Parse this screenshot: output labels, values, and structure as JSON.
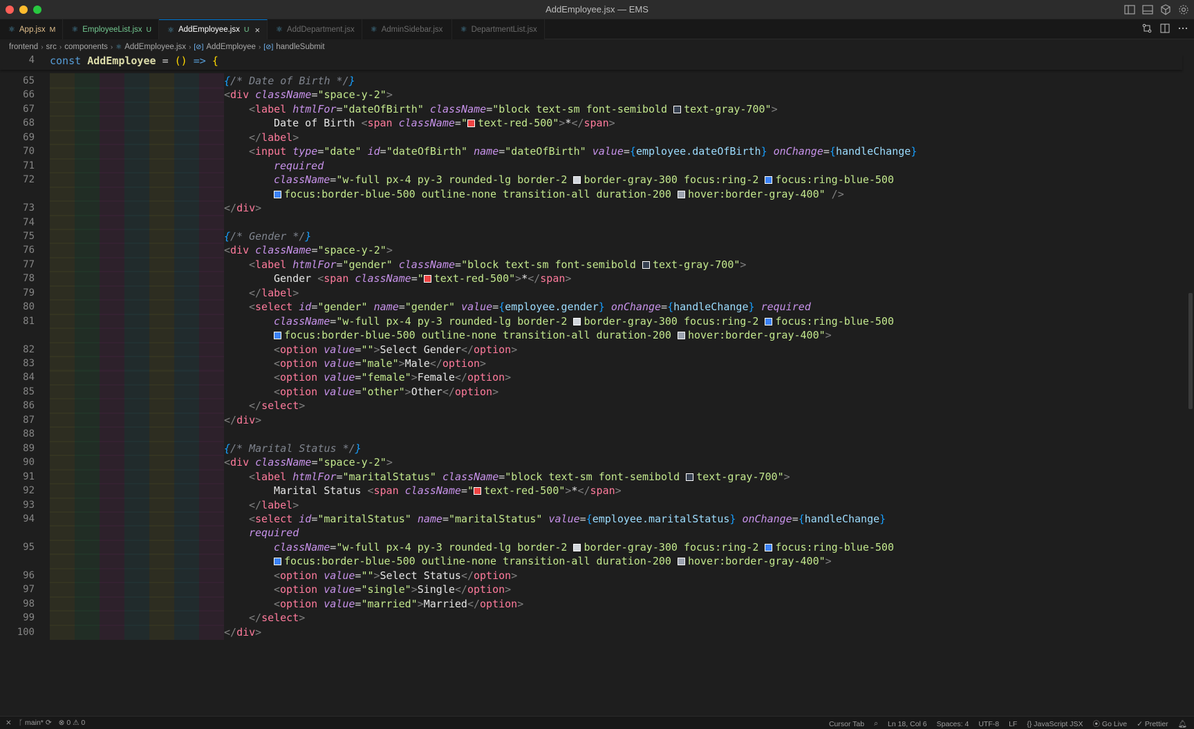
{
  "window": {
    "title": "AddEmployee.jsx — EMS"
  },
  "tabs": [
    {
      "label": "App.jsx",
      "status": "M",
      "state": "modified",
      "icon": "react-icon"
    },
    {
      "label": "EmployeeList.jsx",
      "status": "U",
      "state": "untracked",
      "icon": "react-icon"
    },
    {
      "label": "AddEmployee.jsx",
      "status": "U",
      "state": "active",
      "icon": "react-icon",
      "close": "×"
    },
    {
      "label": "AddDepartment.jsx",
      "status": "",
      "state": "dim",
      "icon": "react-icon"
    },
    {
      "label": "AdminSidebar.jsx",
      "status": "",
      "state": "dim",
      "icon": "react-icon"
    },
    {
      "label": "DepartmentList.jsx",
      "status": "",
      "state": "dim",
      "icon": "react-icon"
    }
  ],
  "breadcrumb": [
    "frontend",
    "src",
    "components",
    "AddEmployee.jsx",
    "AddEmployee",
    "handleSubmit"
  ],
  "editor": {
    "sticky_line": "4",
    "rows": [
      {
        "n": "65",
        "html": "<span class='k-cmg'><span class='k-br'>{</span>/* Date of Birth */<span class='k-br'>}</span></span>",
        "indent": 4
      },
      {
        "n": "66",
        "html": "<span class='k-tag'>&lt;</span><span class='k-tname'>div</span> <span class='k-attr'>className</span>=<span class='k-str'>\"space-y-2\"</span><span class='k-tag'>&gt;</span>",
        "indent": 4
      },
      {
        "n": "67",
        "html": "<span class='k-tag'>&lt;</span><span class='k-tname'>label</span> <span class='k-attr'>htmlFor</span>=<span class='k-str'>\"dateOfBirth\"</span> <span class='k-attr'>className</span>=<span class='k-str'>\"block text-sm font-semibold <i class='swatch' style='background:#374151'></i>text-gray-700\"</span><span class='k-tag'>&gt;</span>",
        "indent": 8
      },
      {
        "n": "68",
        "html": "<span class='k-txt'>Date of Birth </span><span class='k-tag'>&lt;</span><span class='k-tname'>span</span> <span class='k-attr'>className</span>=<span class='k-str'>\"<i class='swatch' style='background:#ef4444'></i>text-red-500\"</span><span class='k-tag'>&gt;</span><span class='k-txt'>*</span><span class='k-tag'>&lt;/</span><span class='k-tname'>span</span><span class='k-tag'>&gt;</span>",
        "indent": 12
      },
      {
        "n": "69",
        "html": "<span class='k-tag'>&lt;/</span><span class='k-tname'>label</span><span class='k-tag'>&gt;</span>",
        "indent": 8
      },
      {
        "n": "70",
        "html": "<span class='k-tag'>&lt;</span><span class='k-tname'>input</span> <span class='k-attr'>type</span>=<span class='k-str'>\"date\"</span> <span class='k-attr'>id</span>=<span class='k-str'>\"dateOfBirth\"</span> <span class='k-attr'>name</span>=<span class='k-str'>\"dateOfBirth\"</span> <span class='k-attr'>value</span>=<span class='k-br'>{</span><span class='k-var'>employee.dateOfBirth</span><span class='k-br'>}</span> <span class='k-attr'>onChange</span>=<span class='k-br'>{</span><span class='k-var'>handleChange</span><span class='k-br'>}</span>",
        "indent": 8
      },
      {
        "n": "71",
        "html": "<span class='k-attr'>required</span>",
        "indent": 12
      },
      {
        "n": "72",
        "html": "<span class='k-attr'>className</span>=<span class='k-str'>\"w-full px-4 py-3 rounded-lg border-2 <i class='swatch' style='background:#d1d5db'></i>border-gray-300 focus:ring-2 <i class='swatch' style='background:#3b82f6'></i>focus:ring-blue-500</span>",
        "indent": 12
      },
      {
        "n": "",
        "html": "<span class='k-str'><i class='swatch' style='background:#3b82f6'></i>focus:border-blue-500 outline-none transition-all duration-200 <i class='swatch' style='background:#9ca3af'></i>hover:border-gray-400\"</span> <span class='k-tag'>/&gt;</span>",
        "indent": 12
      },
      {
        "n": "73",
        "html": "<span class='k-tag'>&lt;/</span><span class='k-tname'>div</span><span class='k-tag'>&gt;</span>",
        "indent": 4
      },
      {
        "n": "74",
        "html": "",
        "indent": 0
      },
      {
        "n": "75",
        "html": "<span class='k-cmg'><span class='k-br'>{</span>/* Gender */<span class='k-br'>}</span></span>",
        "indent": 4
      },
      {
        "n": "76",
        "html": "<span class='k-tag'>&lt;</span><span class='k-tname'>div</span> <span class='k-attr'>className</span>=<span class='k-str'>\"space-y-2\"</span><span class='k-tag'>&gt;</span>",
        "indent": 4
      },
      {
        "n": "77",
        "html": "<span class='k-tag'>&lt;</span><span class='k-tname'>label</span> <span class='k-attr'>htmlFor</span>=<span class='k-str'>\"gender\"</span> <span class='k-attr'>className</span>=<span class='k-str'>\"block text-sm font-semibold <i class='swatch' style='background:#374151'></i>text-gray-700\"</span><span class='k-tag'>&gt;</span>",
        "indent": 8
      },
      {
        "n": "78",
        "html": "<span class='k-txt'>Gender </span><span class='k-tag'>&lt;</span><span class='k-tname'>span</span> <span class='k-attr'>className</span>=<span class='k-str'>\"<i class='swatch' style='background:#ef4444'></i>text-red-500\"</span><span class='k-tag'>&gt;</span><span class='k-txt'>*</span><span class='k-tag'>&lt;/</span><span class='k-tname'>span</span><span class='k-tag'>&gt;</span>",
        "indent": 12
      },
      {
        "n": "79",
        "html": "<span class='k-tag'>&lt;/</span><span class='k-tname'>label</span><span class='k-tag'>&gt;</span>",
        "indent": 8
      },
      {
        "n": "80",
        "html": "<span class='k-tag'>&lt;</span><span class='k-tname'>select</span> <span class='k-attr'>id</span>=<span class='k-str'>\"gender\"</span> <span class='k-attr'>name</span>=<span class='k-str'>\"gender\"</span> <span class='k-attr'>value</span>=<span class='k-br'>{</span><span class='k-var'>employee.gender</span><span class='k-br'>}</span> <span class='k-attr'>onChange</span>=<span class='k-br'>{</span><span class='k-var'>handleChange</span><span class='k-br'>}</span> <span class='k-attr'>required</span>",
        "indent": 8
      },
      {
        "n": "81",
        "html": "<span class='k-attr'>className</span>=<span class='k-str'>\"w-full px-4 py-3 rounded-lg border-2 <i class='swatch' style='background:#d1d5db'></i>border-gray-300 focus:ring-2 <i class='swatch' style='background:#3b82f6'></i>focus:ring-blue-500</span>",
        "indent": 12
      },
      {
        "n": "",
        "html": "<span class='k-str'><i class='swatch' style='background:#3b82f6'></i>focus:border-blue-500 outline-none transition-all duration-200 <i class='swatch' style='background:#9ca3af'></i>hover:border-gray-400\"</span><span class='k-tag'>&gt;</span>",
        "indent": 12
      },
      {
        "n": "82",
        "html": "<span class='k-tag'>&lt;</span><span class='k-tname'>option</span> <span class='k-attr'>value</span>=<span class='k-str'>\"\"</span><span class='k-tag'>&gt;</span><span class='k-txt'>Select Gender</span><span class='k-tag'>&lt;/</span><span class='k-tname'>option</span><span class='k-tag'>&gt;</span>",
        "indent": 12
      },
      {
        "n": "83",
        "html": "<span class='k-tag'>&lt;</span><span class='k-tname'>option</span> <span class='k-attr'>value</span>=<span class='k-str'>\"male\"</span><span class='k-tag'>&gt;</span><span class='k-txt'>Male</span><span class='k-tag'>&lt;/</span><span class='k-tname'>option</span><span class='k-tag'>&gt;</span>",
        "indent": 12
      },
      {
        "n": "84",
        "html": "<span class='k-tag'>&lt;</span><span class='k-tname'>option</span> <span class='k-attr'>value</span>=<span class='k-str'>\"female\"</span><span class='k-tag'>&gt;</span><span class='k-txt'>Female</span><span class='k-tag'>&lt;/</span><span class='k-tname'>option</span><span class='k-tag'>&gt;</span>",
        "indent": 12
      },
      {
        "n": "85",
        "html": "<span class='k-tag'>&lt;</span><span class='k-tname'>option</span> <span class='k-attr'>value</span>=<span class='k-str'>\"other\"</span><span class='k-tag'>&gt;</span><span class='k-txt'>Other</span><span class='k-tag'>&lt;/</span><span class='k-tname'>option</span><span class='k-tag'>&gt;</span>",
        "indent": 12
      },
      {
        "n": "86",
        "html": "<span class='k-tag'>&lt;/</span><span class='k-tname'>select</span><span class='k-tag'>&gt;</span>",
        "indent": 8
      },
      {
        "n": "87",
        "html": "<span class='k-tag'>&lt;/</span><span class='k-tname'>div</span><span class='k-tag'>&gt;</span>",
        "indent": 4
      },
      {
        "n": "88",
        "html": "",
        "indent": 0
      },
      {
        "n": "89",
        "html": "<span class='k-cmg'><span class='k-br'>{</span>/* Marital Status */<span class='k-br'>}</span></span>",
        "indent": 4
      },
      {
        "n": "90",
        "html": "<span class='k-tag'>&lt;</span><span class='k-tname'>div</span> <span class='k-attr'>className</span>=<span class='k-str'>\"space-y-2\"</span><span class='k-tag'>&gt;</span>",
        "indent": 4
      },
      {
        "n": "91",
        "html": "<span class='k-tag'>&lt;</span><span class='k-tname'>label</span> <span class='k-attr'>htmlFor</span>=<span class='k-str'>\"maritalStatus\"</span> <span class='k-attr'>className</span>=<span class='k-str'>\"block text-sm font-semibold <i class='swatch' style='background:#374151'></i>text-gray-700\"</span><span class='k-tag'>&gt;</span>",
        "indent": 8
      },
      {
        "n": "92",
        "html": "<span class='k-txt'>Marital Status </span><span class='k-tag'>&lt;</span><span class='k-tname'>span</span> <span class='k-attr'>className</span>=<span class='k-str'>\"<i class='swatch' style='background:#ef4444'></i>text-red-500\"</span><span class='k-tag'>&gt;</span><span class='k-txt'>*</span><span class='k-tag'>&lt;/</span><span class='k-tname'>span</span><span class='k-tag'>&gt;</span>",
        "indent": 12
      },
      {
        "n": "93",
        "html": "<span class='k-tag'>&lt;/</span><span class='k-tname'>label</span><span class='k-tag'>&gt;</span>",
        "indent": 8
      },
      {
        "n": "94",
        "html": "<span class='k-tag'>&lt;</span><span class='k-tname'>select</span> <span class='k-attr'>id</span>=<span class='k-str'>\"maritalStatus\"</span> <span class='k-attr'>name</span>=<span class='k-str'>\"maritalStatus\"</span> <span class='k-attr'>value</span>=<span class='k-br'>{</span><span class='k-var'>employee.maritalStatus</span><span class='k-br'>}</span> <span class='k-attr'>onChange</span>=<span class='k-br'>{</span><span class='k-var'>handleChange</span><span class='k-br'>}</span>",
        "indent": 8
      },
      {
        "n": "",
        "html": "<span class='k-attr'>required</span>",
        "indent": 8
      },
      {
        "n": "95",
        "html": "<span class='k-attr'>className</span>=<span class='k-str'>\"w-full px-4 py-3 rounded-lg border-2 <i class='swatch' style='background:#d1d5db'></i>border-gray-300 focus:ring-2 <i class='swatch' style='background:#3b82f6'></i>focus:ring-blue-500</span>",
        "indent": 12
      },
      {
        "n": "",
        "html": "<span class='k-str'><i class='swatch' style='background:#3b82f6'></i>focus:border-blue-500 outline-none transition-all duration-200 <i class='swatch' style='background:#9ca3af'></i>hover:border-gray-400\"</span><span class='k-tag'>&gt;</span>",
        "indent": 12
      },
      {
        "n": "96",
        "html": "<span class='k-tag'>&lt;</span><span class='k-tname'>option</span> <span class='k-attr'>value</span>=<span class='k-str'>\"\"</span><span class='k-tag'>&gt;</span><span class='k-txt'>Select Status</span><span class='k-tag'>&lt;/</span><span class='k-tname'>option</span><span class='k-tag'>&gt;</span>",
        "indent": 12
      },
      {
        "n": "97",
        "html": "<span class='k-tag'>&lt;</span><span class='k-tname'>option</span> <span class='k-attr'>value</span>=<span class='k-str'>\"single\"</span><span class='k-tag'>&gt;</span><span class='k-txt'>Single</span><span class='k-tag'>&lt;/</span><span class='k-tname'>option</span><span class='k-tag'>&gt;</span>",
        "indent": 12
      },
      {
        "n": "98",
        "html": "<span class='k-tag'>&lt;</span><span class='k-tname'>option</span> <span class='k-attr'>value</span>=<span class='k-str'>\"married\"</span><span class='k-tag'>&gt;</span><span class='k-txt'>Married</span><span class='k-tag'>&lt;/</span><span class='k-tname'>option</span><span class='k-tag'>&gt;</span>",
        "indent": 12
      },
      {
        "n": "99",
        "html": "<span class='k-tag'>&lt;/</span><span class='k-tname'>select</span><span class='k-tag'>&gt;</span>",
        "indent": 8
      },
      {
        "n": "100",
        "html": "<span class='k-tag'>&lt;/</span><span class='k-tname'>div</span><span class='k-tag'>&gt;</span>",
        "indent": 4
      }
    ]
  },
  "statusbar": {
    "branch": "main*",
    "problems": "0 ⚠ 0",
    "cursor_tab": "Cursor Tab",
    "position": "Ln 18, Col 6",
    "spaces": "Spaces: 4",
    "encoding": "UTF-8",
    "eol": "LF",
    "language": "JavaScript JSX",
    "go_live": "Go Live",
    "prettier": "Prettier"
  },
  "colors": {
    "accent": "#0078d4",
    "guide_colors": [
      "#3a3a24",
      "#243a2c",
      "#3a2436",
      "#243638",
      "#3a3a24",
      "#24363a",
      "#3a2436"
    ]
  }
}
